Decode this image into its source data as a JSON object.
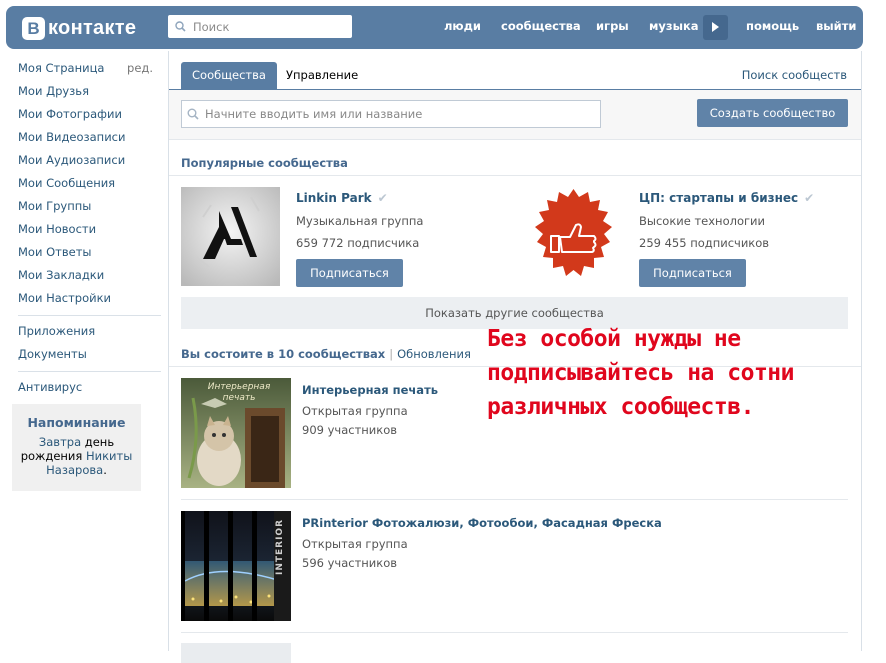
{
  "header": {
    "logo_letter": "В",
    "logo_text": "контакте",
    "search_placeholder": "Поиск",
    "nav": [
      "люди",
      "сообщества",
      "игры",
      "музыка",
      "помощь",
      "выйти"
    ],
    "brand_color": "#597da3"
  },
  "sidebar": {
    "edit_label": "ред.",
    "items": [
      "Моя Страница",
      "Мои Друзья",
      "Мои Фотографии",
      "Мои Видеозаписи",
      "Мои Аудиозаписи",
      "Мои Сообщения",
      "Мои Группы",
      "Мои Новости",
      "Мои Ответы",
      "Мои Закладки",
      "Мои Настройки"
    ],
    "extra": [
      "Приложения",
      "Документы"
    ],
    "antivirus": "Антивирус"
  },
  "reminder": {
    "title": "Напоминание",
    "line1_link": "Завтра",
    "line1_rest": "день",
    "line2_start": "рождения",
    "line2_link": "Никиты",
    "line3_link": "Назарова",
    "line3_end": "."
  },
  "tabs": {
    "active": "Сообщества",
    "manage": "Управление",
    "search": "Поиск сообществ"
  },
  "filter": {
    "placeholder": "Начните вводить имя или название",
    "create_button": "Создать сообщество"
  },
  "popular": {
    "title": "Популярные сообщества",
    "cards": [
      {
        "name": "Linkin Park",
        "type": "Музыкальная группа",
        "subs": "659 772 подписчика",
        "button": "Подписаться"
      },
      {
        "name": "ЦП: стартапы и бизнес",
        "type": "Высокие технологии",
        "subs": "259 455 подписчиков",
        "button": "Подписаться"
      }
    ],
    "show_more": "Показать другие сообщества"
  },
  "membership": {
    "title": "Вы состоите в 10 сообществах",
    "updates": "Обновления",
    "groups": [
      {
        "name": "Интерьерная печать",
        "type": "Открытая группа",
        "count": "909 участников",
        "thumb_text": "Интерьерная печать"
      },
      {
        "name": "PRinterior Фотожалюзи, Фотообои, Фасадная Фреска",
        "type": "Открытая группа",
        "count": "596 участников",
        "thumb_text": "INTERIOR"
      }
    ]
  },
  "overlay_note": "Без особой нужды не подписывайтесь на сотни различных сообществ.",
  "colors": {
    "link": "#2b587a",
    "button": "#6083a8",
    "annotation_red": "#e0061d",
    "badge_orange": "#d2391b"
  }
}
